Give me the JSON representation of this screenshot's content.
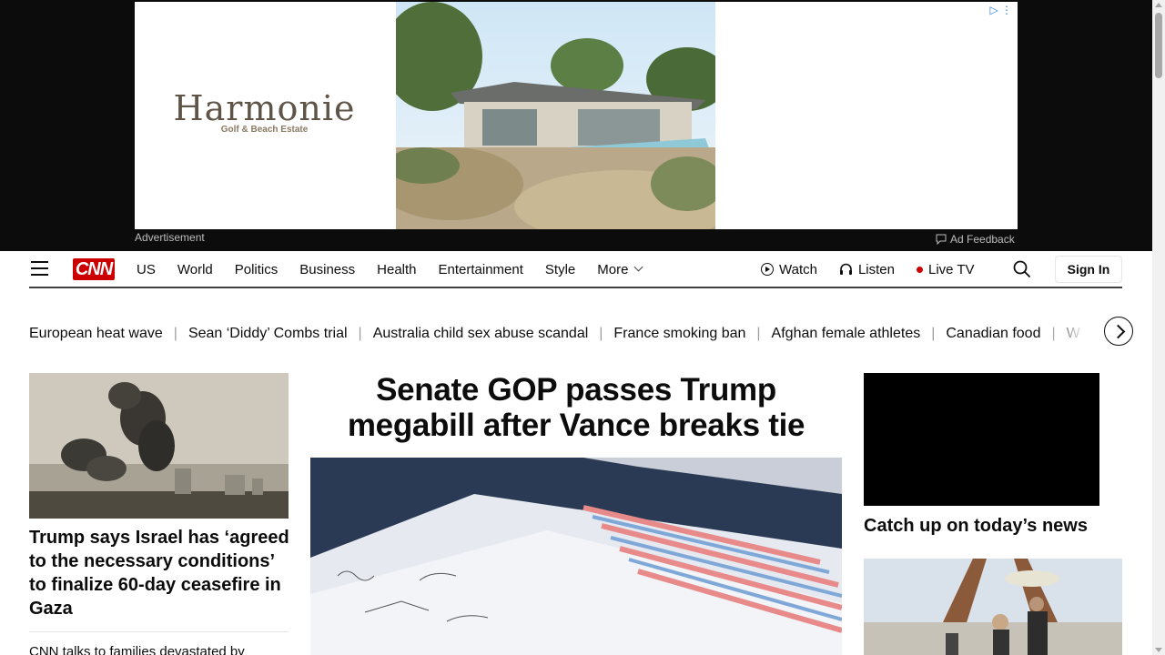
{
  "ad": {
    "brand": "Harmonie",
    "tagline": "Golf & Beach Estate",
    "label": "Advertisement",
    "feedback": "Ad Feedback"
  },
  "header": {
    "nav": [
      "US",
      "World",
      "Politics",
      "Business",
      "Health",
      "Entertainment",
      "Style",
      "More"
    ],
    "watch": "Watch",
    "listen": "Listen",
    "live_tv": "Live TV",
    "sign_in": "Sign In",
    "logo": "CNN"
  },
  "trending": [
    "European heat wave",
    "Sean ‘Diddy’ Combs trial",
    "Australia child sex abuse scandal",
    "France smoking ban",
    "Afghan female athletes",
    "Canadian food",
    "W"
  ],
  "left": {
    "headline": "Trump says Israel has ‘agreed to the necessary conditions’ to finalize 60-day ceasefire in Gaza",
    "sub": "CNN talks to families devastated by"
  },
  "center": {
    "headline": "Senate GOP passes Trump megabill after Vance breaks tie"
  },
  "right": {
    "headline": "Catch up on today’s news"
  },
  "colors": {
    "brand_red": "#cc0000",
    "ad_band": "#0c0c0c"
  }
}
